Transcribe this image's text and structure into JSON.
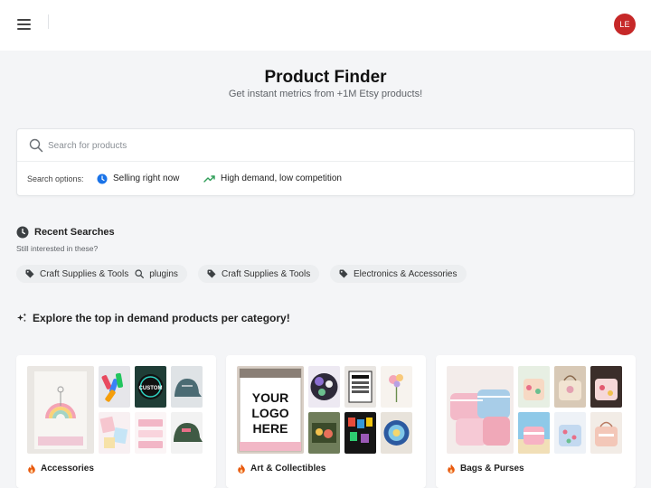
{
  "header": {
    "menu_icon": "hamburger-menu-icon",
    "avatar_initials": "LE",
    "avatar_color": "#c62828"
  },
  "hero": {
    "title": "Product Finder",
    "subtitle": "Get instant metrics from +1M Etsy products!"
  },
  "search": {
    "placeholder": "Search for products",
    "icon": "search-icon",
    "options_label": "Search options:",
    "options": [
      {
        "label": "Selling right now",
        "icon": "clock-icon",
        "color": "#1a73e8"
      },
      {
        "label": "High demand, low competition",
        "icon": "trending-up-icon",
        "color": "#2e9d57"
      }
    ]
  },
  "recent": {
    "title": "Recent Searches",
    "subtitle": "Still interested in these?",
    "icon": "history-icon",
    "items": [
      {
        "category": "Craft Supplies & Tools",
        "query": "plugins"
      },
      {
        "category": "Craft Supplies & Tools",
        "query": ""
      },
      {
        "category": "Electronics & Accessories",
        "query": ""
      }
    ]
  },
  "explore": {
    "title": "Explore the top in demand products per category!",
    "icon": "sparkles-icon",
    "categories": [
      {
        "label": "Accessories",
        "icon": "fire-icon",
        "big_image_text": ""
      },
      {
        "label": "Art & Collectibles",
        "icon": "fire-icon",
        "big_image_text": "YOUR LOGO HERE"
      },
      {
        "label": "Bags & Purses",
        "icon": "fire-icon",
        "big_image_text": ""
      }
    ],
    "accent_color": "#e8590c"
  }
}
